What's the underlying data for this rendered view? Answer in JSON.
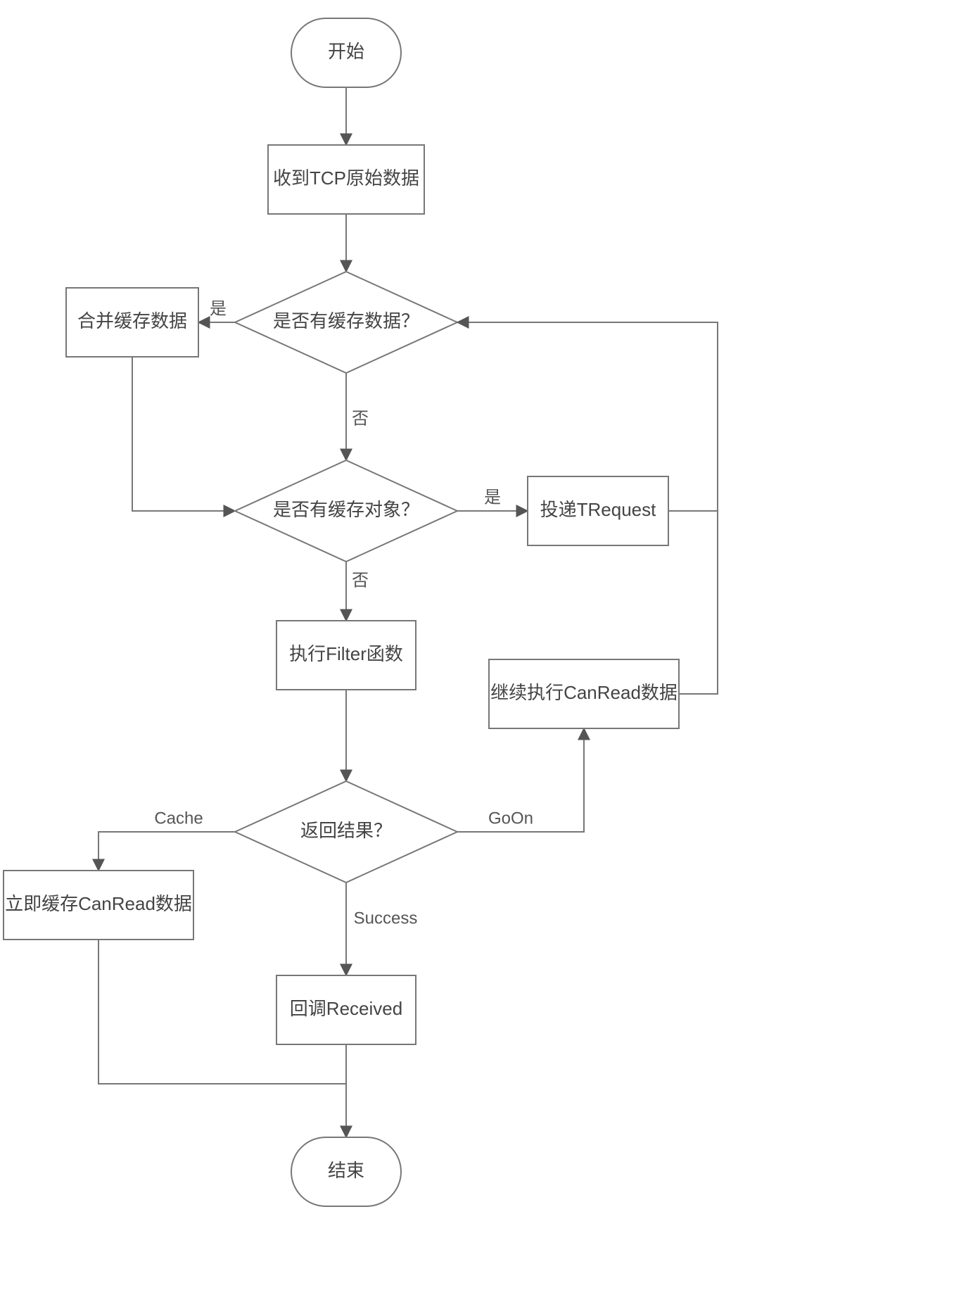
{
  "nodes": {
    "start": {
      "label": "开始"
    },
    "recv_tcp": {
      "label": "收到TCP原始数据"
    },
    "has_cache_data": {
      "label": "是否有缓存数据？"
    },
    "merge_cache": {
      "label": "合并缓存数据"
    },
    "has_cache_obj": {
      "label": "是否有缓存对象？"
    },
    "deliver_treq": {
      "label": "投递TRequest"
    },
    "exec_filter": {
      "label": "执行Filter函数"
    },
    "return_result": {
      "label": "返回结果？"
    },
    "cache_canread": {
      "label": "立即缓存CanRead数据"
    },
    "goon_canread": {
      "label": "继续执行CanRead数据"
    },
    "cb_received": {
      "label": "回调Received"
    },
    "end": {
      "label": "结束"
    }
  },
  "edge_labels": {
    "yes1": "是",
    "no1": "否",
    "yes2": "是",
    "no2": "否",
    "cache": "Cache",
    "goon": "GoOn",
    "success": "Success"
  }
}
